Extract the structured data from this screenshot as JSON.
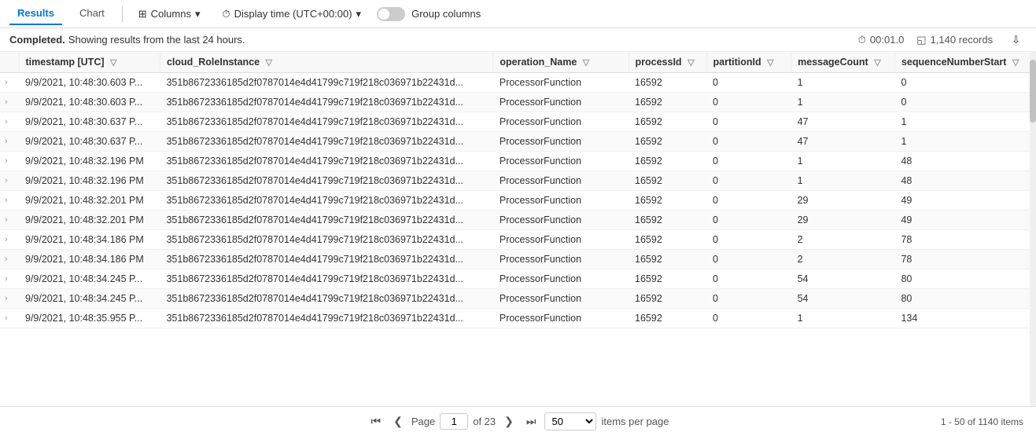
{
  "toolbar": {
    "tab_results": "Results",
    "tab_chart": "Chart",
    "columns_btn": "Columns",
    "display_time_btn": "Display time (UTC+00:00)",
    "group_columns_label": "Group columns",
    "toggle_on": false
  },
  "status": {
    "completed_label": "Completed.",
    "message": " Showing results from the last 24 hours.",
    "duration": "00:01.0",
    "records": "1,140 records"
  },
  "columns": [
    {
      "key": "expand",
      "label": ""
    },
    {
      "key": "timestamp",
      "label": "timestamp [UTC]"
    },
    {
      "key": "cloud_RoleInstance",
      "label": "cloud_RoleInstance"
    },
    {
      "key": "operation_Name",
      "label": "operation_Name"
    },
    {
      "key": "processId",
      "label": "processId"
    },
    {
      "key": "partitionId",
      "label": "partitionId"
    },
    {
      "key": "messageCount",
      "label": "messageCount"
    },
    {
      "key": "sequenceNumberStart",
      "label": "sequenceNumberStart"
    }
  ],
  "rows": [
    {
      "timestamp": "9/9/2021, 10:48:30.603 P...",
      "cloud": "351b8672336185d2f0787014e4d41799c719f218c036971b22431d...",
      "operation": "ProcessorFunction",
      "processId": "16592",
      "partitionId": "0",
      "messageCount": "1",
      "seqNum": "0"
    },
    {
      "timestamp": "9/9/2021, 10:48:30.603 P...",
      "cloud": "351b8672336185d2f0787014e4d41799c719f218c036971b22431d...",
      "operation": "ProcessorFunction",
      "processId": "16592",
      "partitionId": "0",
      "messageCount": "1",
      "seqNum": "0"
    },
    {
      "timestamp": "9/9/2021, 10:48:30.637 P...",
      "cloud": "351b8672336185d2f0787014e4d41799c719f218c036971b22431d...",
      "operation": "ProcessorFunction",
      "processId": "16592",
      "partitionId": "0",
      "messageCount": "47",
      "seqNum": "1"
    },
    {
      "timestamp": "9/9/2021, 10:48:30.637 P...",
      "cloud": "351b8672336185d2f0787014e4d41799c719f218c036971b22431d...",
      "operation": "ProcessorFunction",
      "processId": "16592",
      "partitionId": "0",
      "messageCount": "47",
      "seqNum": "1"
    },
    {
      "timestamp": "9/9/2021, 10:48:32.196 PM",
      "cloud": "351b8672336185d2f0787014e4d41799c719f218c036971b22431d...",
      "operation": "ProcessorFunction",
      "processId": "16592",
      "partitionId": "0",
      "messageCount": "1",
      "seqNum": "48"
    },
    {
      "timestamp": "9/9/2021, 10:48:32.196 PM",
      "cloud": "351b8672336185d2f0787014e4d41799c719f218c036971b22431d...",
      "operation": "ProcessorFunction",
      "processId": "16592",
      "partitionId": "0",
      "messageCount": "1",
      "seqNum": "48"
    },
    {
      "timestamp": "9/9/2021, 10:48:32.201 PM",
      "cloud": "351b8672336185d2f0787014e4d41799c719f218c036971b22431d...",
      "operation": "ProcessorFunction",
      "processId": "16592",
      "partitionId": "0",
      "messageCount": "29",
      "seqNum": "49"
    },
    {
      "timestamp": "9/9/2021, 10:48:32.201 PM",
      "cloud": "351b8672336185d2f0787014e4d41799c719f218c036971b22431d...",
      "operation": "ProcessorFunction",
      "processId": "16592",
      "partitionId": "0",
      "messageCount": "29",
      "seqNum": "49"
    },
    {
      "timestamp": "9/9/2021, 10:48:34.186 PM",
      "cloud": "351b8672336185d2f0787014e4d41799c719f218c036971b22431d...",
      "operation": "ProcessorFunction",
      "processId": "16592",
      "partitionId": "0",
      "messageCount": "2",
      "seqNum": "78"
    },
    {
      "timestamp": "9/9/2021, 10:48:34.186 PM",
      "cloud": "351b8672336185d2f0787014e4d41799c719f218c036971b22431d...",
      "operation": "ProcessorFunction",
      "processId": "16592",
      "partitionId": "0",
      "messageCount": "2",
      "seqNum": "78"
    },
    {
      "timestamp": "9/9/2021, 10:48:34.245 P...",
      "cloud": "351b8672336185d2f0787014e4d41799c719f218c036971b22431d...",
      "operation": "ProcessorFunction",
      "processId": "16592",
      "partitionId": "0",
      "messageCount": "54",
      "seqNum": "80"
    },
    {
      "timestamp": "9/9/2021, 10:48:34.245 P...",
      "cloud": "351b8672336185d2f0787014e4d41799c719f218c036971b22431d...",
      "operation": "ProcessorFunction",
      "processId": "16592",
      "partitionId": "0",
      "messageCount": "54",
      "seqNum": "80"
    },
    {
      "timestamp": "9/9/2021, 10:48:35.955 P...",
      "cloud": "351b8672336185d2f0787014e4d41799c719f218c036971b22431d...",
      "operation": "ProcessorFunction",
      "processId": "16592",
      "partitionId": "0",
      "messageCount": "1",
      "seqNum": "134"
    }
  ],
  "pagination": {
    "page_label": "Page",
    "current_page": "1",
    "of_label": "of 23",
    "items_per_page": "50",
    "items_per_page_label": "items per page",
    "summary": "1 - 50 of 1140 items",
    "first_icon": "⟨⟨",
    "prev_icon": "❮",
    "next_icon": "❯",
    "last_icon": "⟩⟩"
  }
}
